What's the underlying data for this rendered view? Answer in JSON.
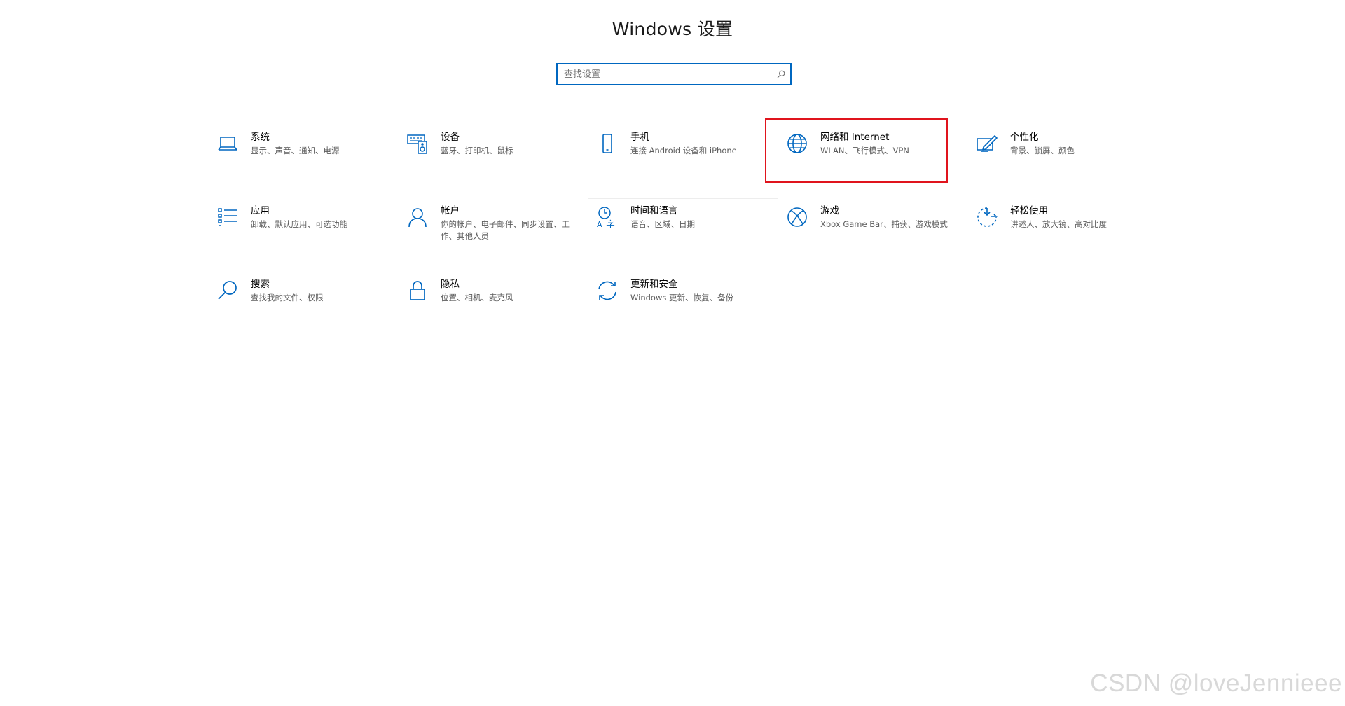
{
  "window": {
    "title": "Windows 设置"
  },
  "search": {
    "placeholder": "查找设置",
    "value": ""
  },
  "accent_color": "#0067c0",
  "highlight_color": "#e0141d",
  "tiles": [
    {
      "icon": "laptop-icon",
      "name": "系统",
      "desc": "显示、声音、通知、电源"
    },
    {
      "icon": "keyboard-speaker-icon",
      "name": "设备",
      "desc": "蓝牙、打印机、鼠标"
    },
    {
      "icon": "phone-icon",
      "name": "手机",
      "desc": "连接 Android 设备和 iPhone"
    },
    {
      "icon": "globe-icon",
      "name": "网络和 Internet",
      "desc": "WLAN、飞行模式、VPN"
    },
    {
      "icon": "paint-brush-icon",
      "name": "个性化",
      "desc": "背景、锁屏、颜色"
    },
    {
      "icon": "apps-list-icon",
      "name": "应用",
      "desc": "卸载、默认应用、可选功能"
    },
    {
      "icon": "person-icon",
      "name": "帐户",
      "desc": "你的帐户、电子邮件、同步设置、工作、其他人员"
    },
    {
      "icon": "time-language-icon",
      "name": "时间和语言",
      "desc": "语音、区域、日期"
    },
    {
      "icon": "xbox-icon",
      "name": "游戏",
      "desc": "Xbox Game Bar、捕获、游戏模式"
    },
    {
      "icon": "ease-of-access-icon",
      "name": "轻松使用",
      "desc": "讲述人、放大镜、高对比度"
    },
    {
      "icon": "search-icon",
      "name": "搜索",
      "desc": "查找我的文件、权限"
    },
    {
      "icon": "lock-icon",
      "name": "隐私",
      "desc": "位置、相机、麦克风"
    },
    {
      "icon": "sync-icon",
      "name": "更新和安全",
      "desc": "Windows 更新、恢复、备份"
    }
  ],
  "watermark": "CSDN @loveJennieee"
}
